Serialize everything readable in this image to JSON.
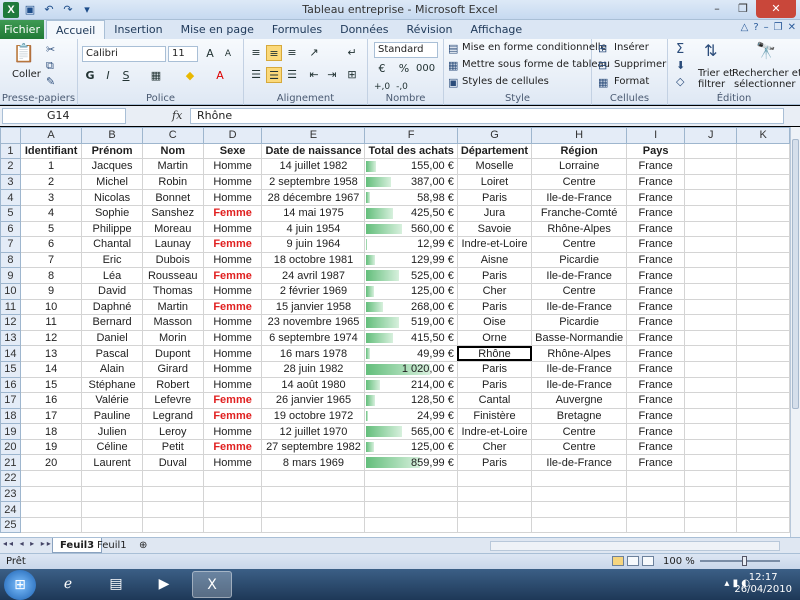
{
  "window": {
    "title": "Tableau entreprise - Microsoft Excel"
  },
  "tabs": {
    "file": "Fichier",
    "items": [
      "Accueil",
      "Insertion",
      "Mise en page",
      "Formules",
      "Données",
      "Révision",
      "Affichage"
    ]
  },
  "ribbon": {
    "clipboard": {
      "paste": "Coller",
      "label": "Presse-papiers"
    },
    "font": {
      "name": "Calibri",
      "size": "11",
      "bold": "G",
      "italic": "I",
      "underline": "S",
      "label": "Police"
    },
    "alignment": {
      "label": "Alignement"
    },
    "number": {
      "format": "Standard",
      "label": "Nombre"
    },
    "style": {
      "conditional": "Mise en forme conditionnelle",
      "table": "Mettre sous forme de tableau",
      "cellstyles": "Styles de cellules",
      "label": "Style"
    },
    "cells": {
      "insert": "Insérer",
      "delete": "Supprimer",
      "format": "Format",
      "label": "Cellules"
    },
    "editing": {
      "sort": "Trier et",
      "sort2": "filtrer",
      "find": "Rechercher et",
      "find2": "sélectionner",
      "label": "Édition"
    }
  },
  "formula_bar": {
    "cell_ref": "G14",
    "fx": "fx",
    "value": "Rhône"
  },
  "grid": {
    "columns": [
      "A",
      "B",
      "C",
      "D",
      "E",
      "F",
      "G",
      "H",
      "I",
      "J",
      "K"
    ],
    "headers": [
      "Identifiant",
      "Prénom",
      "Nom",
      "Sexe",
      "Date de naissance",
      "Total des achats",
      "Département",
      "Région",
      "Pays"
    ],
    "rows": [
      [
        "1",
        "Jacques",
        "Martin",
        "Homme",
        "14 juillet 1982",
        "155,00 €",
        "Moselle",
        "Lorraine",
        "France"
      ],
      [
        "2",
        "Michel",
        "Robin",
        "Homme",
        "2 septembre 1958",
        "387,00 €",
        "Loiret",
        "Centre",
        "France"
      ],
      [
        "3",
        "Nicolas",
        "Bonnet",
        "Homme",
        "28 décembre 1967",
        "58,98 €",
        "Paris",
        "Ile-de-France",
        "France"
      ],
      [
        "4",
        "Sophie",
        "Sanshez",
        "Femme",
        "14 mai 1975",
        "425,50 €",
        "Jura",
        "Franche-Comté",
        "France"
      ],
      [
        "5",
        "Philippe",
        "Moreau",
        "Homme",
        "4 juin 1954",
        "560,00 €",
        "Savoie",
        "Rhône-Alpes",
        "France"
      ],
      [
        "6",
        "Chantal",
        "Launay",
        "Femme",
        "9 juin 1964",
        "12,99 €",
        "Indre-et-Loire",
        "Centre",
        "France"
      ],
      [
        "7",
        "Eric",
        "Dubois",
        "Homme",
        "18 octobre 1981",
        "129,99 €",
        "Aisne",
        "Picardie",
        "France"
      ],
      [
        "8",
        "Léa",
        "Rousseau",
        "Femme",
        "24 avril 1987",
        "525,00 €",
        "Paris",
        "Ile-de-France",
        "France"
      ],
      [
        "9",
        "David",
        "Thomas",
        "Homme",
        "2 février 1969",
        "125,00 €",
        "Cher",
        "Centre",
        "France"
      ],
      [
        "10",
        "Daphné",
        "Martin",
        "Femme",
        "15 janvier 1958",
        "268,00 €",
        "Paris",
        "Ile-de-France",
        "France"
      ],
      [
        "11",
        "Bernard",
        "Masson",
        "Homme",
        "23 novembre 1965",
        "519,00 €",
        "Oise",
        "Picardie",
        "France"
      ],
      [
        "12",
        "Daniel",
        "Morin",
        "Homme",
        "6 septembre 1974",
        "415,50 €",
        "Orne",
        "Basse-Normandie",
        "France"
      ],
      [
        "13",
        "Pascal",
        "Dupont",
        "Homme",
        "16 mars 1978",
        "49,99 €",
        "Rhône",
        "Rhône-Alpes",
        "France"
      ],
      [
        "14",
        "Alain",
        "Girard",
        "Homme",
        "28 juin 1982",
        "1 020,00 €",
        "Paris",
        "Ile-de-France",
        "France"
      ],
      [
        "15",
        "Stéphane",
        "Robert",
        "Homme",
        "14 août 1980",
        "214,00 €",
        "Paris",
        "Ile-de-France",
        "France"
      ],
      [
        "16",
        "Valérie",
        "Lefevre",
        "Femme",
        "26 janvier 1965",
        "128,50 €",
        "Cantal",
        "Auvergne",
        "France"
      ],
      [
        "17",
        "Pauline",
        "Legrand",
        "Femme",
        "19 octobre 1972",
        "24,99 €",
        "Finistère",
        "Bretagne",
        "France"
      ],
      [
        "18",
        "Julien",
        "Leroy",
        "Homme",
        "12 juillet 1970",
        "565,00 €",
        "Indre-et-Loire",
        "Centre",
        "France"
      ],
      [
        "19",
        "Céline",
        "Petit",
        "Femme",
        "27 septembre 1982",
        "125,00 €",
        "Cher",
        "Centre",
        "France"
      ],
      [
        "20",
        "Laurent",
        "Duval",
        "Homme",
        "8 mars 1969",
        "859,99 €",
        "Paris",
        "Ile-de-France",
        "France"
      ]
    ],
    "purchase_values": [
      155,
      387,
      58.98,
      425.5,
      560,
      12.99,
      129.99,
      525,
      125,
      268,
      519,
      415.5,
      49.99,
      1020,
      214,
      128.5,
      24.99,
      565,
      125,
      859.99
    ],
    "total_rows": 25,
    "active_cell": "G14",
    "female_value": "Femme",
    "databar_color": "#63be7b",
    "female_color": "#e02020"
  },
  "sheets": {
    "items": [
      "Feuil3",
      "Feuil1"
    ],
    "active": "Feuil3"
  },
  "status": {
    "ready": "Prêt",
    "zoom": "100 %"
  },
  "taskbar": {
    "time": "12:17",
    "date": "26/04/2010"
  }
}
